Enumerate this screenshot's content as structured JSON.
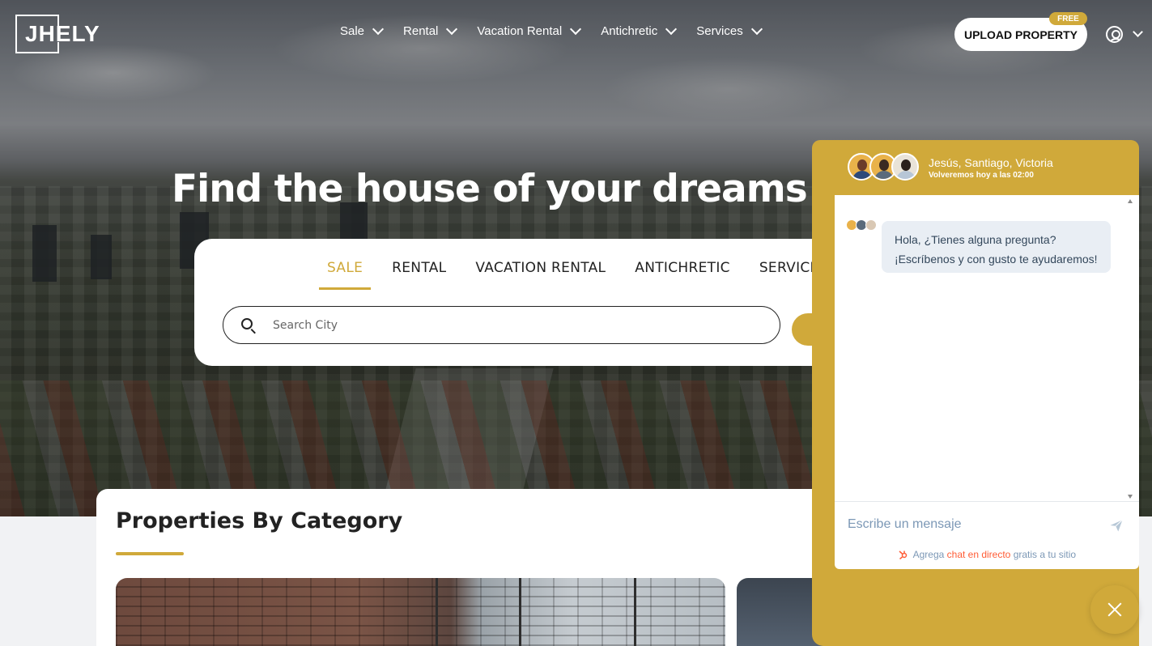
{
  "brand": {
    "logo_text": "JHELY"
  },
  "nav": {
    "items": [
      {
        "label": "Sale"
      },
      {
        "label": "Rental"
      },
      {
        "label": "Vacation Rental"
      },
      {
        "label": "Antichretic"
      },
      {
        "label": "Services"
      }
    ],
    "upload_label": "UPLOAD PROPERTY",
    "free_badge": "FREE"
  },
  "hero": {
    "headline": "Find the house of your dreams in"
  },
  "search": {
    "tabs": [
      {
        "label": "SALE",
        "active": true
      },
      {
        "label": "RENTAL"
      },
      {
        "label": "VACATION RENTAL"
      },
      {
        "label": "ANTICHRETIC"
      },
      {
        "label": "SERVICES"
      }
    ],
    "placeholder": "Search City"
  },
  "categories": {
    "title": "Properties By Category"
  },
  "chat": {
    "agents": "Jesús, Santiago, Victoria",
    "availability": "Volveremos hoy a las 02:00",
    "message_line1": "Hola, ¿Tienes alguna pregunta?",
    "message_line2": "¡Escríbenos y con gusto te ayudaremos!",
    "input_placeholder": "Escribe un mensaje",
    "powered_prefix": "Agrega",
    "powered_link": "chat en directo",
    "powered_suffix": "gratis a tu sitio"
  },
  "colors": {
    "accent": "#d0a93a",
    "hubspot": "#ff5c35"
  }
}
